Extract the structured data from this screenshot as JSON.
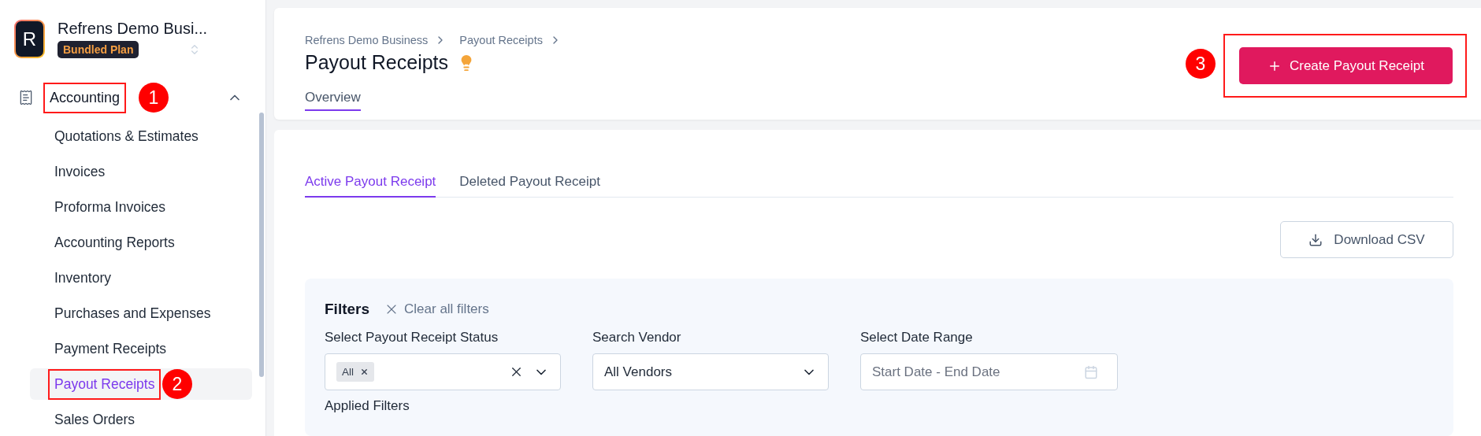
{
  "workspace": {
    "initial": "R",
    "name": "Refrens Demo Busi...",
    "plan": "Bundled Plan"
  },
  "sidebar": {
    "section": {
      "label": "Accounting",
      "expanded": true,
      "callout": "1"
    },
    "items": [
      {
        "label": "Quotations & Estimates",
        "selected": false
      },
      {
        "label": "Invoices",
        "selected": false
      },
      {
        "label": "Proforma Invoices",
        "selected": false
      },
      {
        "label": "Accounting Reports",
        "selected": false
      },
      {
        "label": "Inventory",
        "selected": false
      },
      {
        "label": "Purchases and Expenses",
        "selected": false
      },
      {
        "label": "Payment Receipts",
        "selected": false
      },
      {
        "label": "Payout Receipts",
        "selected": true,
        "callout": "2"
      },
      {
        "label": "Sales Orders",
        "selected": false
      }
    ]
  },
  "breadcrumb": [
    "Refrens Demo Business",
    "Payout Receipts"
  ],
  "title": "Payout Receipts",
  "page_tabs": [
    {
      "label": "Overview",
      "selected": true
    }
  ],
  "create_button": {
    "label": "Create Payout Receipt",
    "callout": "3"
  },
  "tabs": [
    {
      "label": "Active Payout Receipt",
      "selected": true
    },
    {
      "label": "Deleted Payout Receipt",
      "selected": false
    }
  ],
  "download_button": "Download CSV",
  "filters": {
    "title": "Filters",
    "clear": "Clear all filters",
    "fields": [
      {
        "kind": "multiselect",
        "label": "Select Payout Receipt Status",
        "chips": [
          "All"
        ]
      },
      {
        "kind": "select",
        "label": "Search Vendor",
        "value": "All Vendors"
      },
      {
        "kind": "date",
        "label": "Select Date Range",
        "placeholder": "Start Date - End Date"
      }
    ],
    "applied_label": "Applied Filters"
  }
}
